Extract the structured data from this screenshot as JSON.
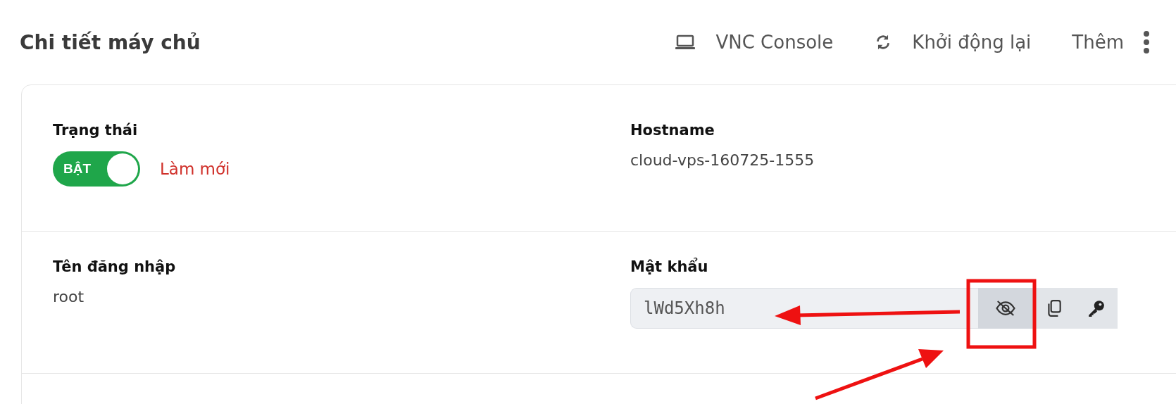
{
  "header": {
    "title": "Chi tiết máy chủ",
    "actions": [
      {
        "kind": "console",
        "label": "VNC Console"
      },
      {
        "kind": "restart",
        "label": "Khởi động lại"
      },
      {
        "kind": "more",
        "label": "Thêm"
      }
    ]
  },
  "details": {
    "status": {
      "label": "Trạng thái",
      "toggle": {
        "on": true,
        "text": "BẬT"
      },
      "refresh": "Làm mới"
    },
    "hostname": {
      "label": "Hostname",
      "value": "cloud-vps-160725-1555"
    },
    "username": {
      "label": "Tên đăng nhập",
      "value": "root"
    },
    "password": {
      "label": "Mật khẩu",
      "value": "lWd5Xh8h",
      "buttons": [
        {
          "kind": "hide",
          "selected": true
        },
        {
          "kind": "copy",
          "selected": false
        },
        {
          "kind": "key",
          "selected": false
        }
      ]
    }
  }
}
